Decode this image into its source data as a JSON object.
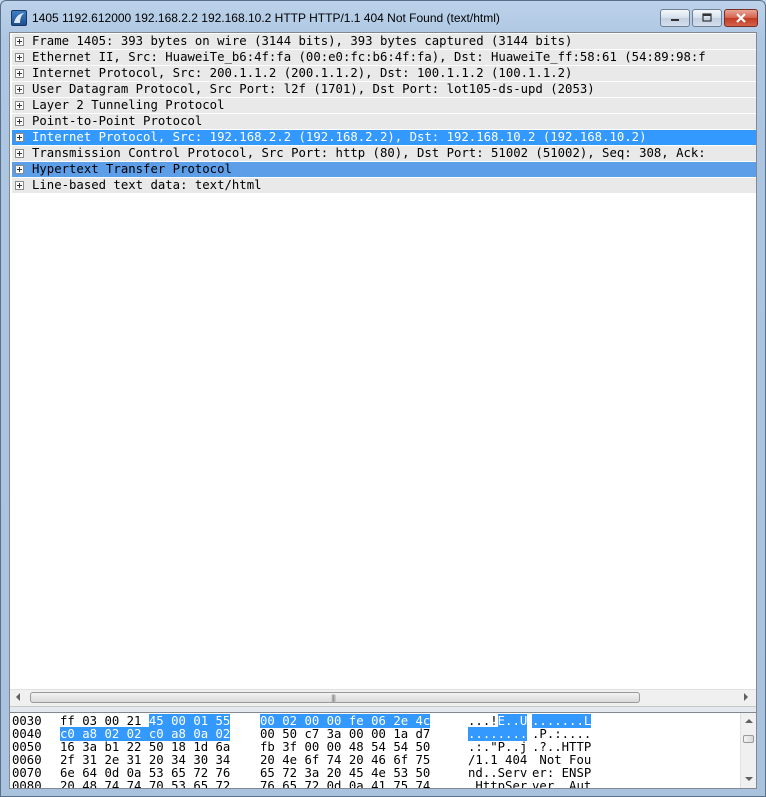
{
  "window": {
    "title": "1405 1192.612000 192.168.2.2 192.168.10.2 HTTP HTTP/1.1 404 Not Found  (text/html)"
  },
  "tree": {
    "rows": [
      {
        "text": "Frame 1405: 393 bytes on wire (3144 bits), 393 bytes captured (3144 bits)",
        "state": "normal"
      },
      {
        "text": "Ethernet II, Src: HuaweiTe_b6:4f:fa (00:e0:fc:b6:4f:fa), Dst: HuaweiTe_ff:58:61 (54:89:98:f",
        "state": "normal"
      },
      {
        "text": "Internet Protocol, Src: 200.1.1.2 (200.1.1.2), Dst: 100.1.1.2 (100.1.1.2)",
        "state": "normal"
      },
      {
        "text": "User Datagram Protocol, Src Port: l2f (1701), Dst Port: lot105-ds-upd (2053)",
        "state": "normal"
      },
      {
        "text": "Layer 2 Tunneling Protocol",
        "state": "normal"
      },
      {
        "text": "Point-to-Point Protocol",
        "state": "normal"
      },
      {
        "text": "Internet Protocol, Src: 192.168.2.2 (192.168.2.2), Dst: 192.168.10.2 (192.168.10.2)",
        "state": "selected"
      },
      {
        "text": "Transmission Control Protocol, Src Port: http (80), Dst Port: 51002 (51002), Seq: 308, Ack:",
        "state": "normal"
      },
      {
        "text": "Hypertext Transfer Protocol",
        "state": "highlight"
      },
      {
        "text": "Line-based text data: text/html",
        "state": "normal"
      }
    ]
  },
  "hex": {
    "lines": [
      {
        "offset": "0030",
        "bytes_a": "ff 03 00 21 45 00 01 55",
        "bytes_b": "00 02 00 00 fe 06 2e 4c",
        "ascii_a": "...!E..U",
        "ascii_b": ".......L"
      },
      {
        "offset": "0040",
        "bytes_a": "c0 a8 02 02 c0 a8 0a 02",
        "bytes_b": "00 50 c7 3a 00 00 1a d7",
        "ascii_a": "........",
        "ascii_b": ".P.:...."
      },
      {
        "offset": "0050",
        "bytes_a": "16 3a b1 22 50 18 1d 6a",
        "bytes_b": "fb 3f 00 00 48 54 54 50",
        "ascii_a": ".:.\"P..j",
        "ascii_b": ".?..HTTP"
      },
      {
        "offset": "0060",
        "bytes_a": "2f 31 2e 31 20 34 30 34",
        "bytes_b": "20 4e 6f 74 20 46 6f 75",
        "ascii_a": "/1.1 404",
        "ascii_b": " Not Fou"
      },
      {
        "offset": "0070",
        "bytes_a": "6e 64 0d 0a 53 65 72 76",
        "bytes_b": "65 72 3a 20 45 4e 53 50",
        "ascii_a": "nd..Serv",
        "ascii_b": "er: ENSP"
      },
      {
        "offset": "0080",
        "bytes_a": "20 48 74 74 70 53 65 72",
        "bytes_b": "76 65 72 0d 0a 41 75 74",
        "ascii_a": " HttpSer",
        "ascii_b": "ver..Aut"
      }
    ],
    "highlight": "45 00 01 55 00 02 00 00 fe 06 2e 4c c0 a8 02 02 c0 a8 0a 02"
  },
  "colors": {
    "selection": "#3399ff",
    "row_background": "#e9e9e9",
    "highlight_row": "#5c9ee8"
  }
}
